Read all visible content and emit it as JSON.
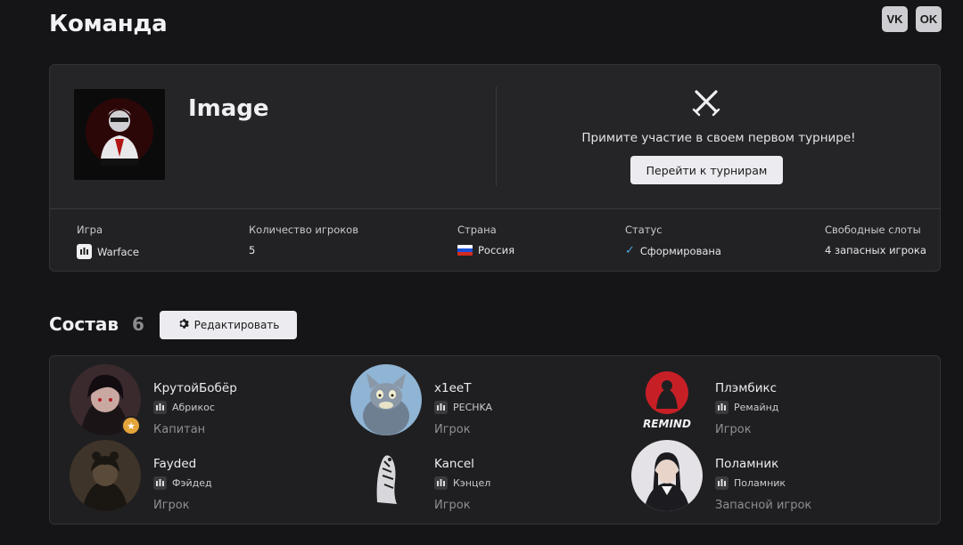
{
  "header": {
    "title": "Команда"
  },
  "social": {
    "vk_label": "VK",
    "ok_label": "OK"
  },
  "team": {
    "name": "Image",
    "logo_icon": "team-logo-hoodie-figure",
    "promo": {
      "icon": "crossed-swords-icon",
      "text": "Примите участие в своем первом турнире!",
      "button": "Перейти к турнирам"
    },
    "info": {
      "game_label": "Игра",
      "game_value": "Warface",
      "players_label": "Количество игроков",
      "players_value": "5",
      "country_label": "Страна",
      "country_value": "Россия",
      "status_label": "Статус",
      "status_value": "Сформирована",
      "slots_label": "Свободные слоты",
      "slots_value": "4 запасных игрока"
    }
  },
  "roster": {
    "title": "Состав",
    "count": "6",
    "edit_button": "Редактировать",
    "players": [
      {
        "name": "КрутойБобёр",
        "nick": "Абрикос",
        "role": "Капитан",
        "captain": true
      },
      {
        "name": "x1eeT",
        "nick": "PECHKA",
        "role": "Игрок",
        "captain": false
      },
      {
        "name": "Плэмбикс",
        "nick": "Ремайнд",
        "role": "Игрок",
        "captain": false,
        "avatar_text": "REMIND"
      },
      {
        "name": "Fayded",
        "nick": "Фэйдед",
        "role": "Игрок",
        "captain": false
      },
      {
        "name": "Kancel",
        "nick": "Кэнцел",
        "role": "Игрок",
        "captain": false
      },
      {
        "name": "Поламник",
        "nick": "Поламник",
        "role": "Запасной игрок",
        "captain": false
      }
    ]
  },
  "colors": {
    "background": "#151517",
    "card": "#222224",
    "accent_check": "#4aa3df",
    "captain_badge": "#e3a43a"
  }
}
